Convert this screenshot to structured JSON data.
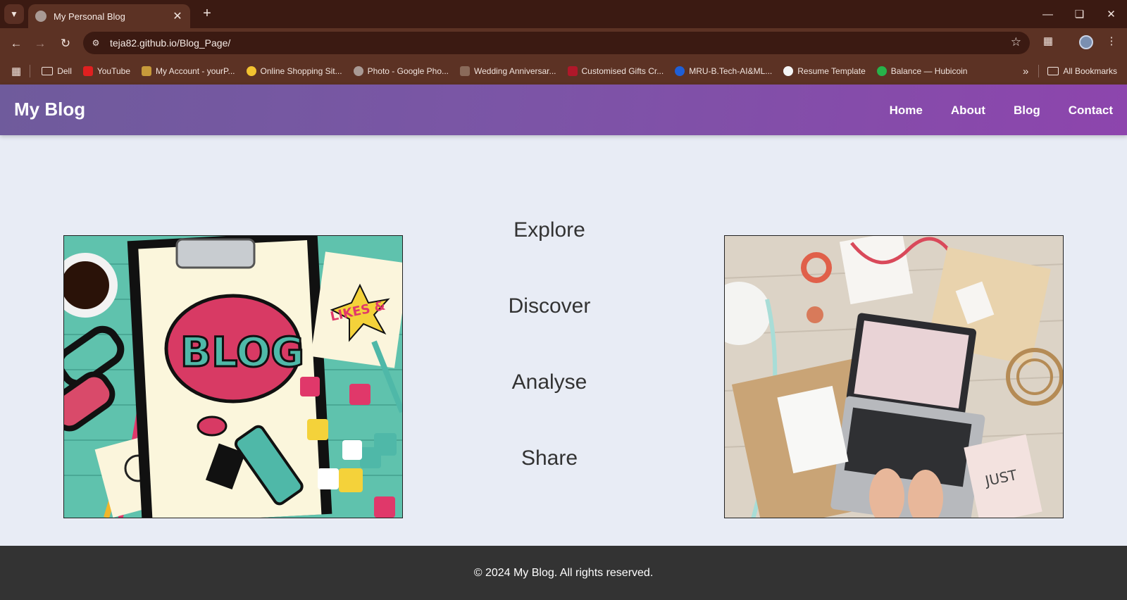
{
  "browser": {
    "tab_title": "My Personal Blog",
    "url": "teja82.github.io/Blog_Page/",
    "bookmarks": [
      {
        "label": "Dell",
        "icon": "folder-icon"
      },
      {
        "label": "YouTube",
        "icon": "youtube-icon"
      },
      {
        "label": "My Account - yourP...",
        "icon": "yp-icon"
      },
      {
        "label": "Online Shopping Sit...",
        "icon": "flipkart-icon"
      },
      {
        "label": "Photo - Google Pho...",
        "icon": "globe-icon"
      },
      {
        "label": "Wedding Anniversar...",
        "icon": "image-icon"
      },
      {
        "label": "Customised Gifts Cr...",
        "icon": "gift-icon"
      },
      {
        "label": "MRU-B.Tech-AI&ML...",
        "icon": "c-icon"
      },
      {
        "label": "Resume Template",
        "icon": "resume-icon"
      },
      {
        "label": "Balance — Hubicoin",
        "icon": "hubicoin-icon"
      }
    ],
    "all_bookmarks_label": "All Bookmarks"
  },
  "site": {
    "logo": "My Blog",
    "nav": [
      "Home",
      "About",
      "Blog",
      "Contact"
    ],
    "words": [
      "Explore",
      "Discover",
      "Analyse",
      "Share"
    ],
    "footer": "© 2024 My Blog. All rights reserved."
  },
  "colors": {
    "header_gradient_start": "#6f5b9c",
    "header_gradient_end": "#8d45ad",
    "page_bg": "#e8ecf5",
    "footer_bg": "#333333"
  }
}
